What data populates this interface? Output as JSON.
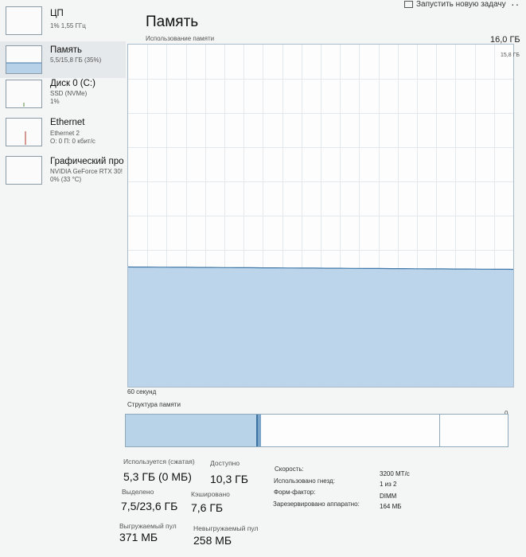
{
  "header": {
    "run_task": "Запустить новую задачу",
    "more": "··"
  },
  "sidebar": {
    "items": [
      {
        "title": "ЦП",
        "line1": "1% 1,55 ГГц",
        "line2": ""
      },
      {
        "title": "Память",
        "line1": "5,5/15,8 ГБ (35%)",
        "line2": ""
      },
      {
        "title": "Диск 0 (C:)",
        "line1": "SSD (NVMe)",
        "line2": "1%"
      },
      {
        "title": "Ethernet",
        "line1": "Ethernet 2",
        "line2": "О: 0 П: 0 кбит/с"
      },
      {
        "title": "Графический про",
        "line1": "NVIDIA GeForce RTX 30!",
        "line2": "0% (33 °C)"
      }
    ]
  },
  "main": {
    "title": "Память",
    "usage_label": "Использование памяти",
    "max_label": "16,0 ГБ",
    "sub_max": "15,8 ГБ",
    "time_label": "60 секунд",
    "zero_label": "0",
    "structure_label": "Структура памяти",
    "usage_fraction": 0.35
  },
  "stats": {
    "in_use_label": "Используется (сжатая)",
    "in_use_value": "5,3 ГБ (0 МБ)",
    "available_label": "Доступно",
    "available_value": "10,3 ГБ",
    "committed_label": "Выделено",
    "committed_value": "7,5/23,6 ГБ",
    "cached_label": "Кэшировано",
    "cached_value": "7,6 ГБ",
    "paged_label": "Выгружаемый пул",
    "paged_value": "371 МБ",
    "nonpaged_label": "Невыгружаемый пул",
    "nonpaged_value": "258 МБ"
  },
  "details": [
    {
      "label": "Скорость:",
      "value": "3200 МТ/с"
    },
    {
      "label": "Использовано гнезд:",
      "value": "1 из 2"
    },
    {
      "label": "Форм-фактор:",
      "value": "DIMM"
    },
    {
      "label": "Зарезервировано аппаратно:",
      "value": "164 МБ"
    }
  ],
  "colors": {
    "memory_fill": "#b7d1e8",
    "memory_line": "#3f78a8",
    "grid": "#e3e8ec",
    "border": "#a8bccb"
  }
}
